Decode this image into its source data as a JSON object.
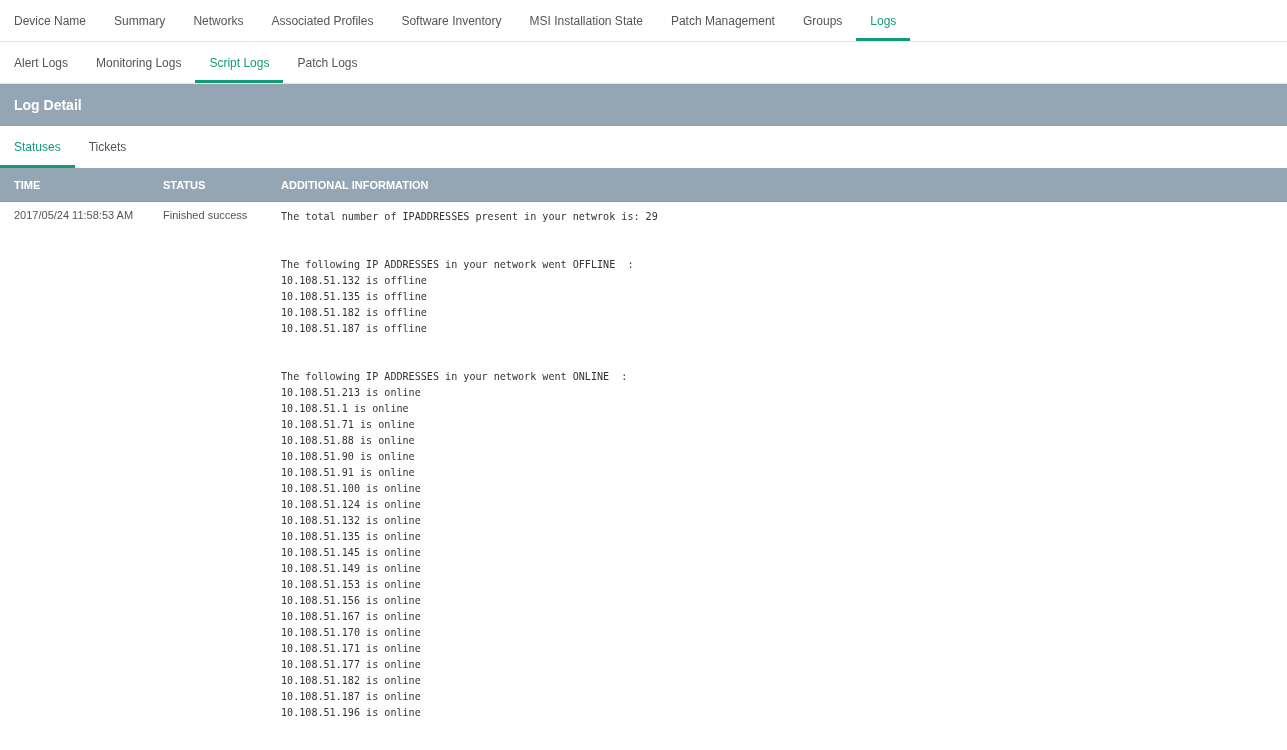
{
  "main_tabs": [
    {
      "label": "Device Name",
      "selected": false
    },
    {
      "label": "Summary",
      "selected": false
    },
    {
      "label": "Networks",
      "selected": false
    },
    {
      "label": "Associated Profiles",
      "selected": false
    },
    {
      "label": "Software Inventory",
      "selected": false
    },
    {
      "label": "MSI Installation State",
      "selected": false
    },
    {
      "label": "Patch Management",
      "selected": false
    },
    {
      "label": "Groups",
      "selected": false
    },
    {
      "label": "Logs",
      "selected": true
    }
  ],
  "log_tabs": [
    {
      "label": "Alert Logs",
      "selected": false
    },
    {
      "label": "Monitoring Logs",
      "selected": false
    },
    {
      "label": "Script Logs",
      "selected": true
    },
    {
      "label": "Patch Logs",
      "selected": false
    }
  ],
  "panel": {
    "title": "Log Detail"
  },
  "detail_tabs": [
    {
      "label": "Statuses",
      "selected": true
    },
    {
      "label": "Tickets",
      "selected": false
    }
  ],
  "table": {
    "columns": [
      "TIME",
      "STATUS",
      "ADDITIONAL INFORMATION"
    ],
    "rows": [
      {
        "time": "2017/05/24 11:58:53 AM",
        "status": "Finished success",
        "info_blocks": [
          [
            "The total number of IPADDRESSES present in your netwrok is: 29"
          ],
          [
            "The following IP ADDRESSES in your network went OFFLINE  :",
            "10.108.51.132 is offline",
            "10.108.51.135 is offline",
            "10.108.51.182 is offline",
            "10.108.51.187 is offline"
          ],
          [
            "The following IP ADDRESSES in your network went ONLINE  :",
            "10.108.51.213 is online",
            "10.108.51.1 is online",
            "10.108.51.71 is online",
            "10.108.51.88 is online",
            "10.108.51.90 is online",
            "10.108.51.91 is online",
            "10.108.51.100 is online",
            "10.108.51.124 is online",
            "10.108.51.132 is online",
            "10.108.51.135 is online",
            "10.108.51.145 is online",
            "10.108.51.149 is online",
            "10.108.51.153 is online",
            "10.108.51.156 is online",
            "10.108.51.167 is online",
            "10.108.51.170 is online",
            "10.108.51.171 is online",
            "10.108.51.177 is online",
            "10.108.51.182 is online",
            "10.108.51.187 is online",
            "10.108.51.196 is online"
          ]
        ]
      }
    ]
  }
}
